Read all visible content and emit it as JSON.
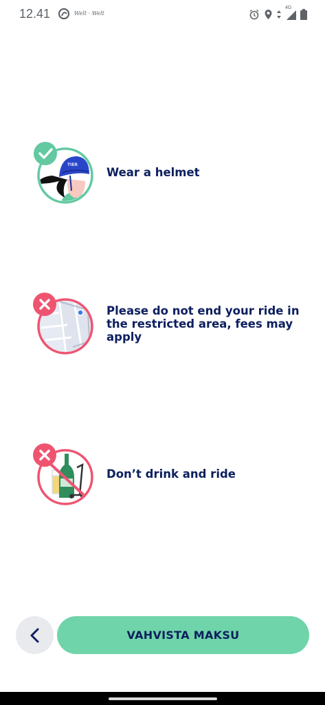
{
  "status_bar": {
    "time": "12.41",
    "apps_text": "Welt · Welt",
    "icons": [
      "alarm-icon",
      "location-icon",
      "data-arrows-icon",
      "signal-4g-icon",
      "battery-icon"
    ],
    "network": "4G"
  },
  "rules": [
    {
      "text": "Wear a helmet",
      "status": "allowed",
      "icon": "helmet-illustration"
    },
    {
      "text": "Please do not end your ride in the restricted area, fees may apply",
      "status": "forbidden",
      "icon": "restricted-area-map-illustration"
    },
    {
      "text": "Don’t drink and ride",
      "status": "forbidden",
      "icon": "no-drinking-illustration"
    }
  ],
  "buttons": {
    "back_icon": "chevron-left-icon",
    "confirm_label": "VAHVISTA MAKSU"
  },
  "colors": {
    "title_text": "#0d1f5e",
    "confirm_button": "#6fd4a9",
    "allowed_badge": "#62c9a1",
    "forbidden_badge": "#ee5470",
    "back_button": "#e8eaed"
  }
}
